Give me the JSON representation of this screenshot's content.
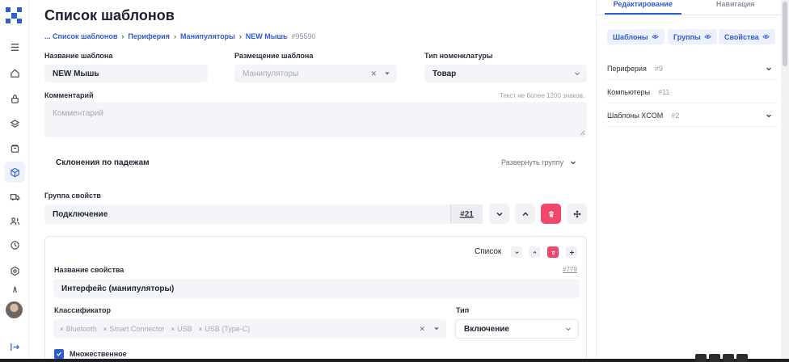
{
  "rail": {
    "icons": [
      "menu-icon",
      "home-icon",
      "lock-icon",
      "layers-icon",
      "box-icon",
      "cube-icon",
      "truck-icon",
      "users-icon",
      "clock-icon",
      "settings-icon",
      "logout-icon"
    ],
    "accent": "#2f5bd3"
  },
  "header": {
    "title": "Список шаблонов",
    "breadcrumbs": [
      "... Список шаблонов",
      "Периферия",
      "Манипуляторы",
      "NEW Мышь"
    ],
    "record_id": "#95590"
  },
  "form": {
    "name_label": "Название шаблона",
    "name_value": "NEW Мышь",
    "placement_label": "Размещение шаблона",
    "placement_value": "Манипуляторы",
    "type_label": "Тип номенклатуры",
    "type_value": "Товар",
    "comment_label": "Комментарий",
    "comment_hint": "Текст не более 1200 знаков.",
    "comment_placeholder": "Комментарий"
  },
  "declension": {
    "title": "Склонения по падежам",
    "expand_label": "Развернуть группу"
  },
  "property_group": {
    "label": "Группа свойств",
    "value": "Подключение",
    "id": "#21"
  },
  "property_card": {
    "view_label": "Список",
    "name_label": "Название свойства",
    "id": "#779",
    "name_value": "Интерфейс (манипуляторы)",
    "classifier_label": "Классификатор",
    "classifier_tags": [
      "Bluetooth",
      "Smart Connector",
      "USB",
      "USB (Type-C)"
    ],
    "type_label": "Тип",
    "type_value": "Включение",
    "multiple_label": "Множественное",
    "delete_color": "#f2466b"
  },
  "panel": {
    "tabs": [
      "Редактирование",
      "Навигация"
    ],
    "chips": [
      "Шаблоны",
      "Группы",
      "Свойства"
    ],
    "tree": [
      {
        "label": "Периферия",
        "count": "#9"
      },
      {
        "label": "Компьютеры",
        "count": "#11"
      },
      {
        "label": "Шаблоны XCOM",
        "count": "#2"
      }
    ]
  }
}
